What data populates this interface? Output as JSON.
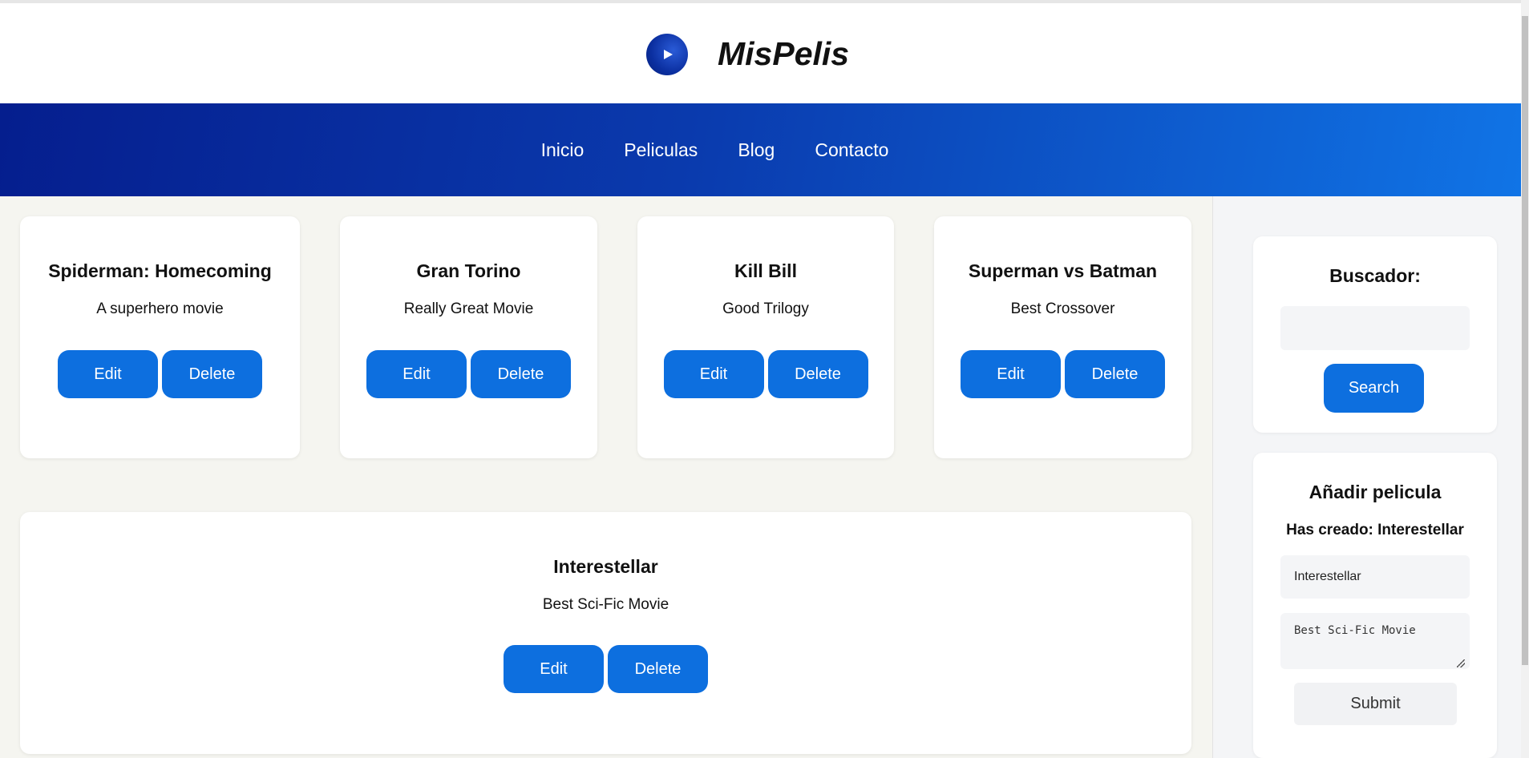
{
  "header": {
    "brand": "MisPelis",
    "logo_icon": "play-icon"
  },
  "nav": {
    "items": [
      {
        "label": "Inicio"
      },
      {
        "label": "Peliculas"
      },
      {
        "label": "Blog"
      },
      {
        "label": "Contacto"
      }
    ]
  },
  "movies": [
    {
      "title": "Spiderman: Homecoming",
      "description": "A superhero movie",
      "edit_label": "Edit",
      "delete_label": "Delete"
    },
    {
      "title": "Gran Torino",
      "description": "Really Great Movie",
      "edit_label": "Edit",
      "delete_label": "Delete"
    },
    {
      "title": "Kill Bill",
      "description": "Good Trilogy",
      "edit_label": "Edit",
      "delete_label": "Delete"
    },
    {
      "title": "Superman vs Batman",
      "description": "Best Crossover",
      "edit_label": "Edit",
      "delete_label": "Delete"
    },
    {
      "title": "Interestellar",
      "description": "Best Sci-Fic Movie",
      "edit_label": "Edit",
      "delete_label": "Delete"
    }
  ],
  "sidebar": {
    "search": {
      "title": "Buscador:",
      "input_value": "",
      "button_label": "Search"
    },
    "add_movie": {
      "title": "Añadir pelicula",
      "created_message": "Has creado: Interestellar",
      "title_field_value": "Interestellar",
      "description_field_value": "Best Sci-Fic Movie",
      "submit_label": "Submit"
    }
  },
  "colors": {
    "primary_button": "#0d6fdf",
    "nav_gradient_start": "#051e8e",
    "nav_gradient_end": "#1074e6"
  }
}
